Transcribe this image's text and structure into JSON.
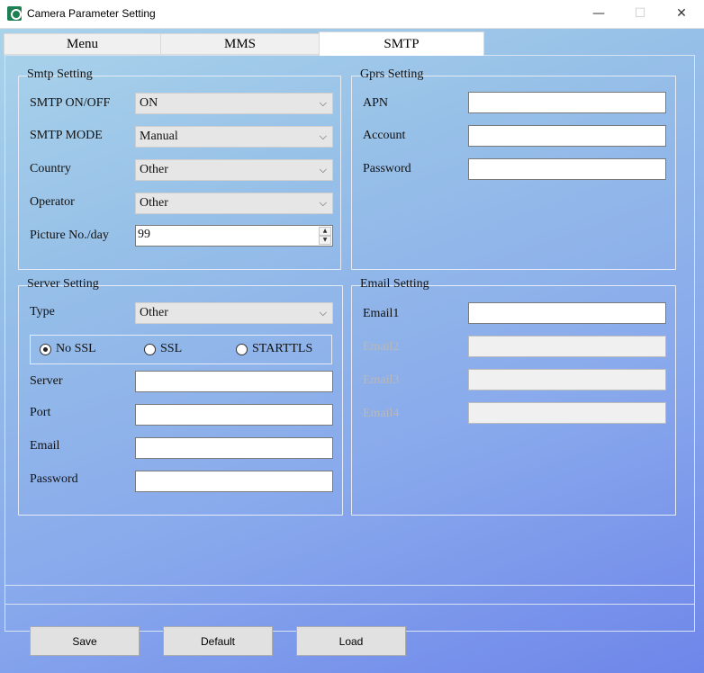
{
  "window": {
    "title": "Camera Parameter Setting",
    "minimize": "—",
    "maximize": "☐",
    "close": "✕"
  },
  "tabs": [
    {
      "label": "Menu",
      "active": false
    },
    {
      "label": "MMS",
      "active": false
    },
    {
      "label": "SMTP",
      "active": true
    }
  ],
  "smtp_setting": {
    "title": "Smtp Setting",
    "on_off": {
      "label": "SMTP ON/OFF",
      "value": "ON"
    },
    "mode": {
      "label": "SMTP MODE",
      "value": "Manual"
    },
    "country": {
      "label": "Country",
      "value": "Other"
    },
    "operator": {
      "label": "Operator",
      "value": "Other"
    },
    "picture": {
      "label": "Picture No./day",
      "value": "99"
    }
  },
  "gprs_setting": {
    "title": "Gprs Setting",
    "apn": {
      "label": "APN",
      "value": ""
    },
    "account": {
      "label": "Account",
      "value": ""
    },
    "password": {
      "label": "Password",
      "value": ""
    }
  },
  "server_setting": {
    "title": "Server Setting",
    "type": {
      "label": "Type",
      "value": "Other"
    },
    "ssl_options": [
      {
        "label": "No SSL",
        "checked": true
      },
      {
        "label": "SSL",
        "checked": false
      },
      {
        "label": "STARTTLS",
        "checked": false
      }
    ],
    "server": {
      "label": "Server",
      "value": ""
    },
    "port": {
      "label": "Port",
      "value": ""
    },
    "email": {
      "label": "Email",
      "value": ""
    },
    "password": {
      "label": "Password",
      "value": ""
    }
  },
  "email_setting": {
    "title": "Email Setting",
    "email1": {
      "label": "Email1",
      "value": "",
      "enabled": true
    },
    "email2": {
      "label": "Email2",
      "value": "",
      "enabled": false
    },
    "email3": {
      "label": "Email3",
      "value": "",
      "enabled": false
    },
    "email4": {
      "label": "Email4",
      "value": "",
      "enabled": false
    }
  },
  "buttons": {
    "save": "Save",
    "default": "Default",
    "load": "Load"
  },
  "icons": {
    "dropdown": "chevron-down-icon",
    "spin_up": "▲",
    "spin_down": "▼",
    "chevron": "⌵"
  }
}
